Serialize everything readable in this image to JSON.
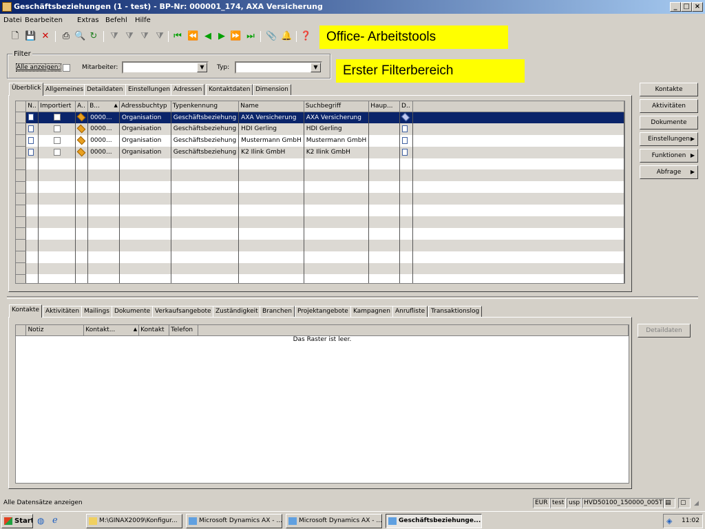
{
  "window": {
    "title": "Geschäftsbeziehungen (1 - test) - BP-Nr: 000001_174, AXA Versicherung",
    "controls": [
      "_",
      "□",
      "×"
    ]
  },
  "menu": [
    "Datei",
    "Bearbeiten",
    "Extras",
    "Befehl",
    "Hilfe"
  ],
  "toolbar_icons": [
    "new-icon",
    "save-icon",
    "delete-icon",
    "print-icon",
    "print-preview-icon",
    "refresh-icon",
    "filter-icon",
    "filter-selection-icon",
    "advanced-filter-icon",
    "remove-filter-icon",
    "first-record-icon",
    "previous-page-icon",
    "previous-record-icon",
    "next-record-icon",
    "next-page-icon",
    "last-record-icon",
    "document-handling-icon",
    "alert-icon",
    "help-icon"
  ],
  "annotations": {
    "office": "Office- Arbeitstools",
    "filter": "Erster Filterbereich"
  },
  "filter": {
    "group_label": "Filter",
    "show_all_label": "Alle anzeigen:",
    "employee_label": "Mitarbeiter:",
    "employee_value": "",
    "type_label": "Typ:",
    "type_value": ""
  },
  "top_tabs": [
    "Überblick",
    "Allgemeines",
    "Detaildaten",
    "Einstellungen",
    "Adressen",
    "Kontaktdaten",
    "Dimension"
  ],
  "grid": {
    "columns": [
      "N..",
      "Importiert",
      "A..",
      "B...",
      "Adressbuchtyp",
      "Typenkennung",
      "Name",
      "Suchbegriff",
      "Haup...",
      "D.."
    ],
    "sort_indicator": "▲",
    "rows": [
      {
        "nr": "0000...",
        "type": "Organisation",
        "kind": "Geschäftsbeziehung",
        "name": "AXA Versicherung",
        "search": "AXA Versicherung",
        "selected": true
      },
      {
        "nr": "0000...",
        "type": "Organisation",
        "kind": "Geschäftsbeziehung",
        "name": "HDI Gerling",
        "search": "HDI Gerling",
        "selected": false
      },
      {
        "nr": "0000...",
        "type": "Organisation",
        "kind": "Geschäftsbeziehung",
        "name": "Mustermann GmbH",
        "search": "Mustermann GmbH",
        "selected": false
      },
      {
        "nr": "0000...",
        "type": "Organisation",
        "kind": "Geschäftsbeziehung",
        "name": "K2 Ilink GmbH",
        "search": "K2 Ilink GmbH",
        "selected": false
      }
    ]
  },
  "right_buttons": [
    {
      "label": "Kontakte",
      "submenu": false
    },
    {
      "label": "Aktivitäten",
      "submenu": false
    },
    {
      "label": "Dokumente",
      "submenu": false
    },
    {
      "label": "Einstellungen",
      "submenu": true
    },
    {
      "label": "Funktionen",
      "submenu": true
    },
    {
      "label": "Abfrage",
      "submenu": true
    }
  ],
  "bottom_tabs": [
    "Kontakte",
    "Aktivitäten",
    "Mailings",
    "Dokumente",
    "Verkaufsangebote",
    "Zuständigkeit",
    "Branchen",
    "Projektangebote",
    "Kampagnen",
    "Anrufliste",
    "Transaktionslog"
  ],
  "bottom_grid": {
    "columns": [
      "Notiz",
      "Kontakt...",
      "Kontakt",
      "Telefon"
    ],
    "sort_indicator": "▲",
    "empty_text": "Das Raster ist leer."
  },
  "detail_button": "Detaildaten",
  "status": {
    "text": "Alle Datensätze anzeigen",
    "currency": "EUR",
    "company": "test",
    "layer": "usp",
    "build": "HVD50100_150000_005T"
  },
  "taskbar": {
    "start": "Start",
    "items": [
      {
        "label": "M:\\GINAX2009\\Konfigur...",
        "active": false
      },
      {
        "label": "Microsoft Dynamics AX - ...",
        "active": false
      },
      {
        "label": "Microsoft Dynamics AX - ...",
        "active": false
      },
      {
        "label": "Geschäftsbeziehunge...",
        "active": true
      }
    ],
    "clock": "11:02"
  }
}
